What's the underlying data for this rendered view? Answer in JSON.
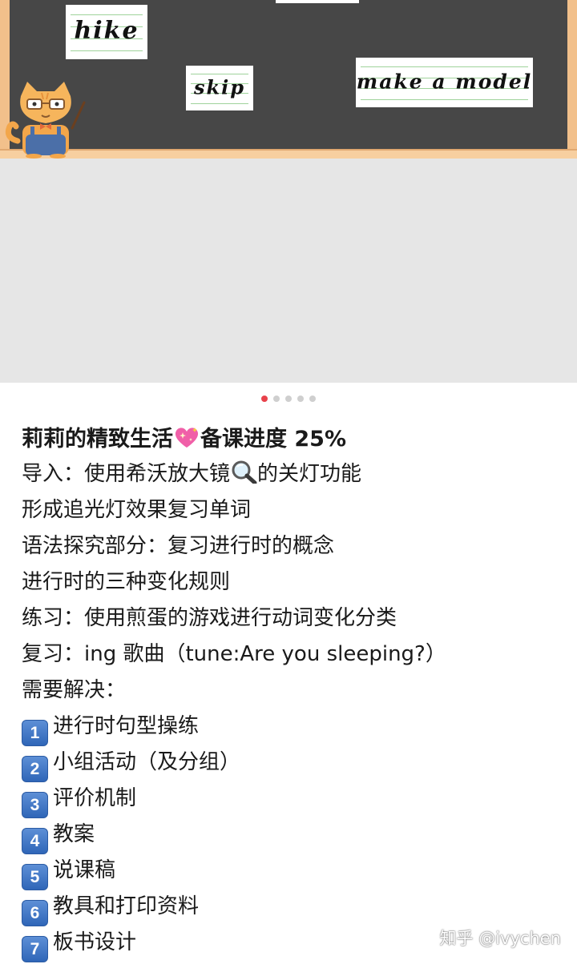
{
  "hero": {
    "cards": [
      "hike",
      "skip",
      "make a model"
    ]
  },
  "carousel": {
    "total": 5,
    "active": 1
  },
  "post": {
    "title_before": "莉莉的精致生活",
    "title_emoji": "sparkling-heart-icon",
    "title_after": "备课进度 25%",
    "lines": [
      {
        "before": "导入：使用希沃放大镜",
        "emoji": "magnifier-icon",
        "after": "的关灯功能"
      },
      {
        "text": "形成追光灯效果复习单词"
      },
      {
        "text": "语法探究部分：复习进行时的概念"
      },
      {
        "text": "进行时的三种变化规则"
      },
      {
        "text": "练习：使用煎蛋的游戏进行动词变化分类"
      },
      {
        "text": "复习：ing 歌曲（tune:Are you sleeping?）"
      },
      {
        "text": "需要解决："
      }
    ],
    "todo": [
      {
        "num": "1",
        "label": "进行时句型操练"
      },
      {
        "num": "2",
        "label": "小组活动（及分组）"
      },
      {
        "num": "3",
        "label": "评价机制"
      },
      {
        "num": "4",
        "label": "教案"
      },
      {
        "num": "5",
        "label": "说课稿"
      },
      {
        "num": "6",
        "label": "教具和打印资料"
      },
      {
        "num": "7",
        "label": "板书设计"
      }
    ]
  },
  "watermark": "知乎 @ivychen",
  "colors": {
    "board": "#474747",
    "frame": "#f2c08b",
    "dot_active": "#e8414b",
    "keycap": "#3b73c6"
  }
}
